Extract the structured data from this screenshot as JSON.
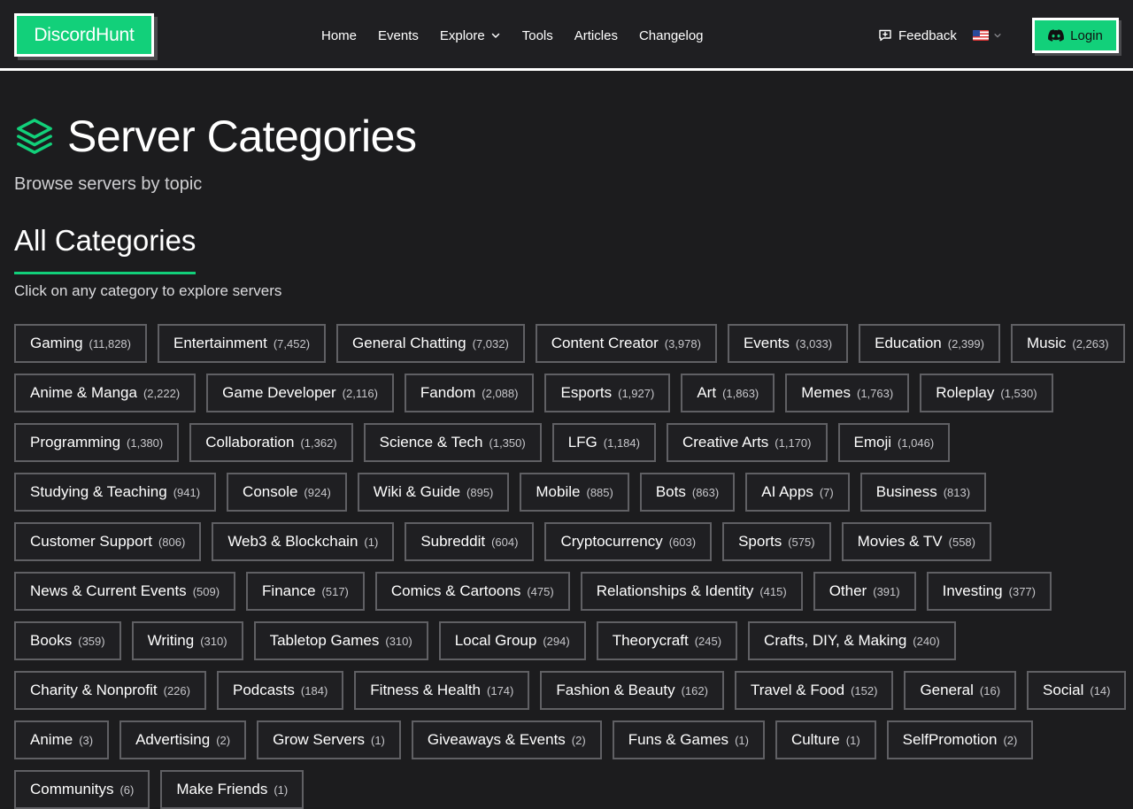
{
  "header": {
    "logo": "DiscordHunt",
    "nav": [
      {
        "label": "Home"
      },
      {
        "label": "Events"
      },
      {
        "label": "Explore",
        "dropdown": true
      },
      {
        "label": "Tools"
      },
      {
        "label": "Articles"
      },
      {
        "label": "Changelog"
      }
    ],
    "feedback_label": "Feedback",
    "language": "en-US",
    "login_label": "Login"
  },
  "page": {
    "title": "Server Categories",
    "subtitle": "Browse servers by topic",
    "section_title": "All Categories",
    "section_hint": "Click on any category to explore servers"
  },
  "colors": {
    "accent": "#12d07a",
    "background": "#1c1c1e",
    "chip_border": "#606064"
  },
  "categories": [
    {
      "name": "Gaming",
      "count": "(11,828)"
    },
    {
      "name": "Entertainment",
      "count": "(7,452)"
    },
    {
      "name": "General Chatting",
      "count": "(7,032)"
    },
    {
      "name": "Content Creator",
      "count": "(3,978)"
    },
    {
      "name": "Events",
      "count": "(3,033)"
    },
    {
      "name": "Education",
      "count": "(2,399)"
    },
    {
      "name": "Music",
      "count": "(2,263)"
    },
    {
      "name": "Anime & Manga",
      "count": "(2,222)"
    },
    {
      "name": "Game Developer",
      "count": "(2,116)"
    },
    {
      "name": "Fandom",
      "count": "(2,088)"
    },
    {
      "name": "Esports",
      "count": "(1,927)"
    },
    {
      "name": "Art",
      "count": "(1,863)"
    },
    {
      "name": "Memes",
      "count": "(1,763)"
    },
    {
      "name": "Roleplay",
      "count": "(1,530)"
    },
    {
      "name": "Programming",
      "count": "(1,380)"
    },
    {
      "name": "Collaboration",
      "count": "(1,362)"
    },
    {
      "name": "Science & Tech",
      "count": "(1,350)"
    },
    {
      "name": "LFG",
      "count": "(1,184)"
    },
    {
      "name": "Creative Arts",
      "count": "(1,170)"
    },
    {
      "name": "Emoji",
      "count": "(1,046)"
    },
    {
      "name": "Studying & Teaching",
      "count": "(941)"
    },
    {
      "name": "Console",
      "count": "(924)"
    },
    {
      "name": "Wiki & Guide",
      "count": "(895)"
    },
    {
      "name": "Mobile",
      "count": "(885)"
    },
    {
      "name": "Bots",
      "count": "(863)"
    },
    {
      "name": "AI Apps",
      "count": "(7)"
    },
    {
      "name": "Business",
      "count": "(813)"
    },
    {
      "name": "Customer Support",
      "count": "(806)"
    },
    {
      "name": "Web3 & Blockchain",
      "count": "(1)"
    },
    {
      "name": "Subreddit",
      "count": "(604)"
    },
    {
      "name": "Cryptocurrency",
      "count": "(603)"
    },
    {
      "name": "Sports",
      "count": "(575)"
    },
    {
      "name": "Movies & TV",
      "count": "(558)"
    },
    {
      "name": "News & Current Events",
      "count": "(509)"
    },
    {
      "name": "Finance",
      "count": "(517)"
    },
    {
      "name": "Comics & Cartoons",
      "count": "(475)"
    },
    {
      "name": "Relationships & Identity",
      "count": "(415)"
    },
    {
      "name": "Other",
      "count": "(391)"
    },
    {
      "name": "Investing",
      "count": "(377)"
    },
    {
      "name": "Books",
      "count": "(359)"
    },
    {
      "name": "Writing",
      "count": "(310)"
    },
    {
      "name": "Tabletop Games",
      "count": "(310)"
    },
    {
      "name": "Local Group",
      "count": "(294)"
    },
    {
      "name": "Theorycraft",
      "count": "(245)"
    },
    {
      "name": "Crafts, DIY, & Making",
      "count": "(240)"
    },
    {
      "name": "Charity & Nonprofit",
      "count": "(226)"
    },
    {
      "name": "Podcasts",
      "count": "(184)"
    },
    {
      "name": "Fitness & Health",
      "count": "(174)"
    },
    {
      "name": "Fashion & Beauty",
      "count": "(162)"
    },
    {
      "name": "Travel & Food",
      "count": "(152)"
    },
    {
      "name": "General",
      "count": "(16)"
    },
    {
      "name": "Social",
      "count": "(14)"
    },
    {
      "name": "Anime",
      "count": "(3)"
    },
    {
      "name": "Advertising",
      "count": "(2)"
    },
    {
      "name": "Grow Servers",
      "count": "(1)"
    },
    {
      "name": "Giveaways & Events",
      "count": "(2)"
    },
    {
      "name": "Funs & Games",
      "count": "(1)"
    },
    {
      "name": "Culture",
      "count": "(1)"
    },
    {
      "name": "SelfPromotion",
      "count": "(2)"
    },
    {
      "name": "Communitys",
      "count": "(6)"
    },
    {
      "name": "Make Friends",
      "count": "(1)"
    }
  ]
}
